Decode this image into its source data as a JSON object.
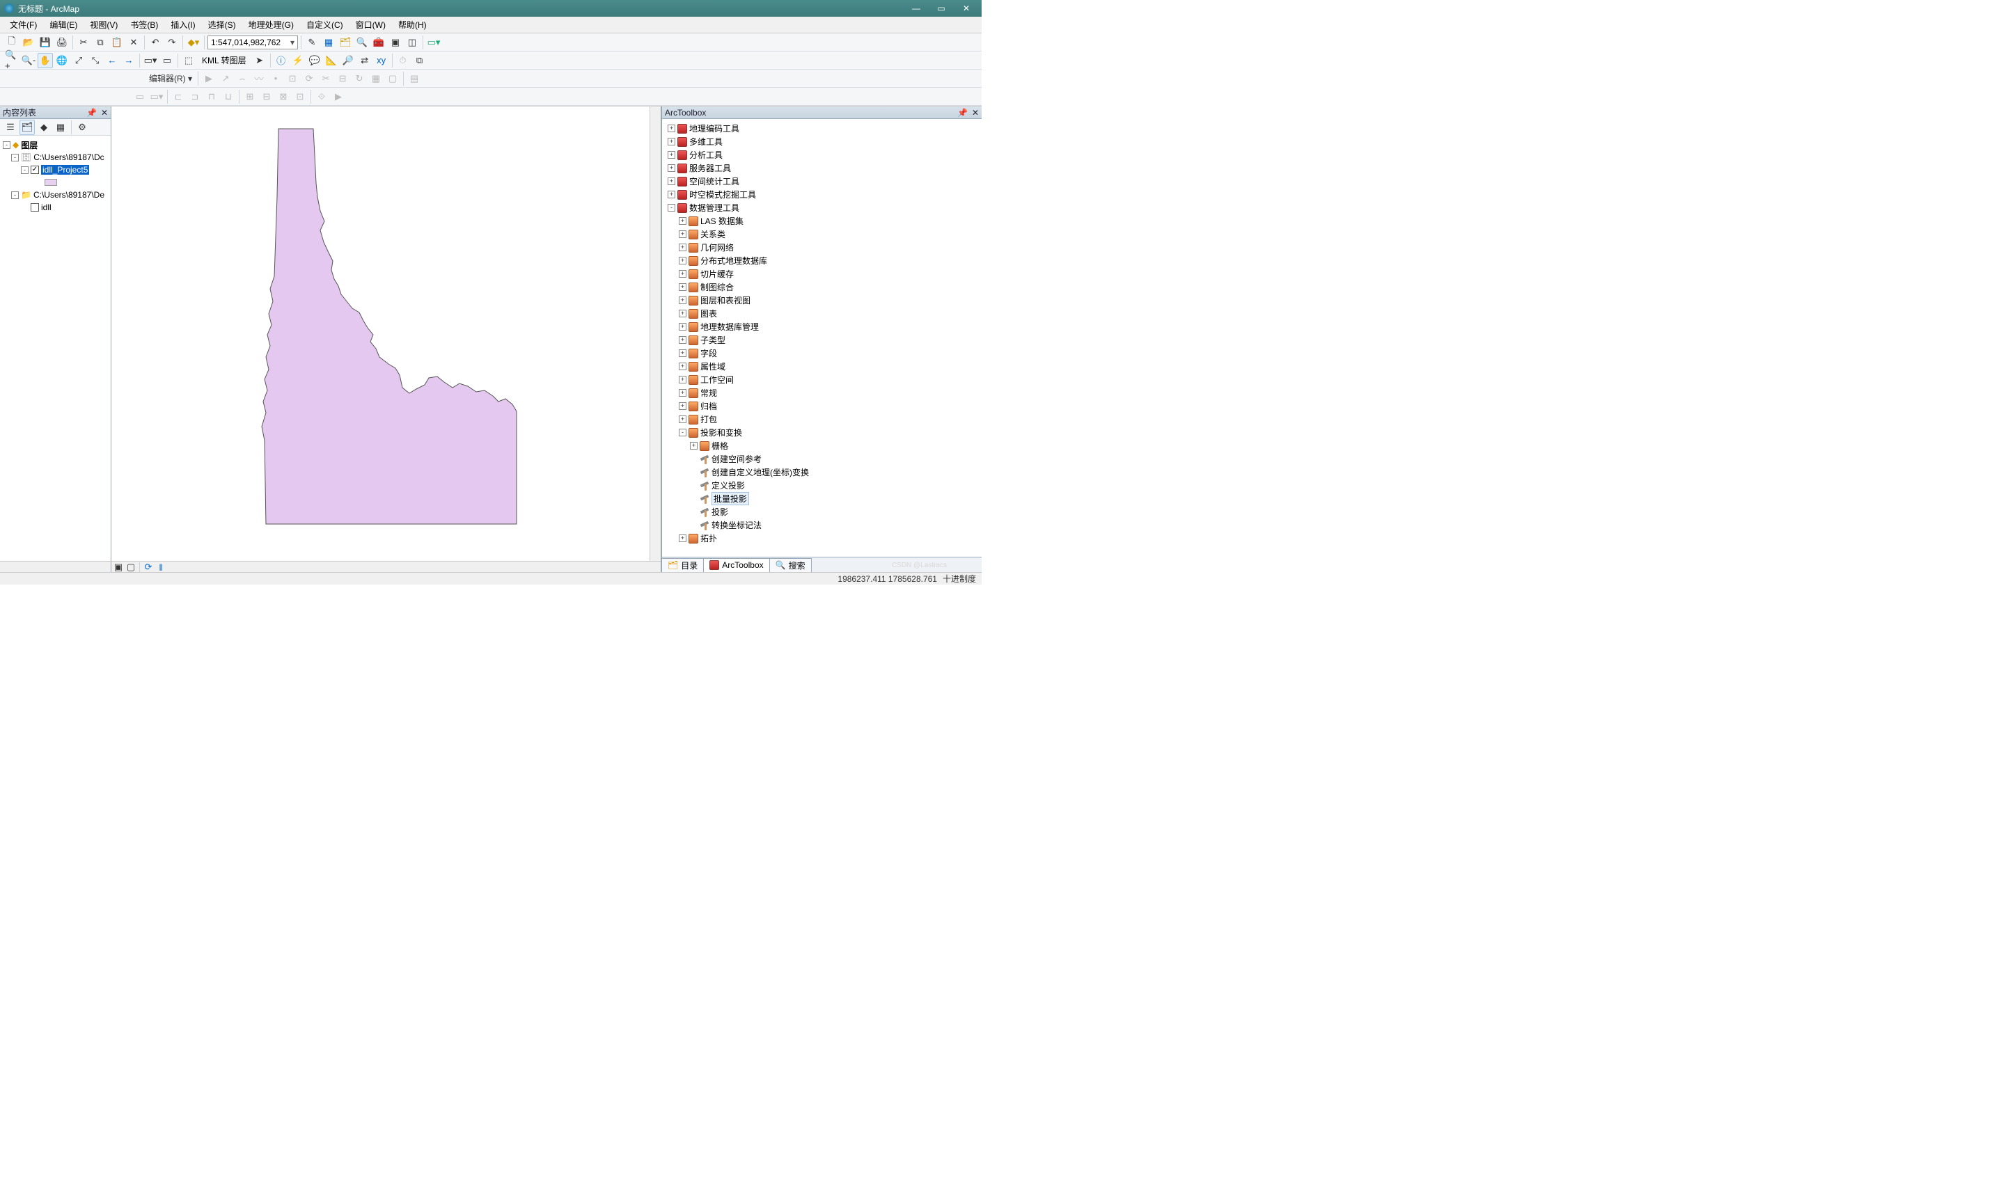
{
  "titlebar": {
    "title": "无标题 - ArcMap"
  },
  "menu": [
    "文件(F)",
    "编辑(E)",
    "视图(V)",
    "书签(B)",
    "插入(I)",
    "选择(S)",
    "地理处理(G)",
    "自定义(C)",
    "窗口(W)",
    "帮助(H)"
  ],
  "toolbar1": {
    "scale": "1:547,014,982,762",
    "kml_label": "KML 转图层"
  },
  "toolbar3": {
    "editor_label": "编辑器(R)  ▾"
  },
  "toc": {
    "title": "内容列表",
    "root": "图层",
    "gdb_path": "C:\\Users\\89187\\Dc",
    "layer_selected": "idll_Project5",
    "folder_path": "C:\\Users\\89187\\De",
    "layer_unchecked": "idll"
  },
  "toolbox": {
    "title": "ArcToolbox",
    "groups_top": [
      "地理编码工具",
      "多维工具",
      "分析工具",
      "服务器工具",
      "空间统计工具",
      "时空模式挖掘工具"
    ],
    "dm_label": "数据管理工具",
    "dm_children": [
      "LAS 数据集",
      "关系类",
      "几何网络",
      "分布式地理数据库",
      "切片缓存",
      "制图综合",
      "图层和表视图",
      "图表",
      "地理数据库管理",
      "子类型",
      "字段",
      "属性域",
      "工作空间",
      "常规",
      "归档",
      "打包"
    ],
    "proj_label": "投影和变换",
    "proj_grid": "栅格",
    "proj_tools": [
      "创建空间参考",
      "创建自定义地理(坐标)变换",
      "定义投影",
      "批量投影",
      "投影",
      "转换坐标记法"
    ],
    "topo_label": "拓扑",
    "tabs": {
      "catalog": "目录",
      "toolbox": "ArcToolbox",
      "search": "搜索"
    }
  },
  "status": {
    "coords": "1986237.411  1785628.761",
    "units": "十进制度"
  },
  "watermark": "CSDN @Lastracs"
}
